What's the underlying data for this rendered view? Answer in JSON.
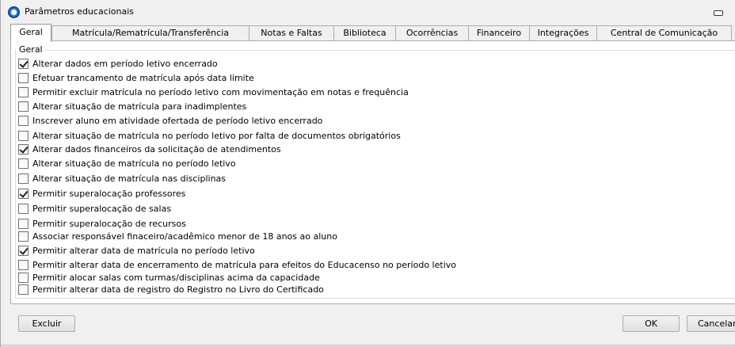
{
  "window": {
    "title": "Parâmetros educacionais"
  },
  "icons": {
    "app": "app-globe-icon",
    "minimize": "minimize-icon"
  },
  "tabs": [
    {
      "label": "Geral",
      "active": true
    },
    {
      "label": "Matrícula/Rematrícula/Transferência",
      "active": false
    },
    {
      "label": "Notas e Faltas",
      "active": false
    },
    {
      "label": "Biblioteca",
      "active": false
    },
    {
      "label": "Ocorrências",
      "active": false
    },
    {
      "label": "Financeiro",
      "active": false
    },
    {
      "label": "Integrações",
      "active": false
    },
    {
      "label": "Central de Comunicação",
      "active": false
    }
  ],
  "group": {
    "label": "Geral"
  },
  "options": [
    {
      "label": "Alterar dados em período letivo encerrado",
      "checked": true
    },
    {
      "label": "Efetuar trancamento de matrícula após data limite",
      "checked": false
    },
    {
      "label": "Permitir excluir matrícula no período letivo com movimentação em notas e frequência",
      "checked": false
    },
    {
      "label": "Alterar situação de matrícula para inadimplentes",
      "checked": false
    },
    {
      "label": "Inscrever aluno em atividade ofertada de período letivo encerrado",
      "checked": false
    },
    {
      "label": "Alterar situação de matrícula no período letivo por falta de documentos obrigatórios",
      "checked": false
    },
    {
      "label": "Alterar dados financeiros da solicitação de atendimentos",
      "checked": true
    },
    {
      "label": "Alterar situação de matrícula no período letivo",
      "checked": false
    },
    {
      "label": "Alterar situação de matrícula nas disciplinas",
      "checked": false
    },
    {
      "label": "Permitir superalocação professores",
      "checked": true
    },
    {
      "label": "Permitir superalocação de salas",
      "checked": false
    },
    {
      "label": "Permitir superalocação de recursos",
      "checked": false
    },
    {
      "label": "Associar responsável finaceiro/acadêmico menor de 18 anos ao aluno",
      "checked": false
    },
    {
      "label": "Permitir alterar data de matrícula no período letivo",
      "checked": true
    },
    {
      "label": "Permitir alterar data de encerramento de matrícula para efeitos do Educacenso no período letivo",
      "checked": false
    },
    {
      "label": "Permitir alocar salas com turmas/disciplinas acima da capacidade",
      "checked": false
    },
    {
      "label": "Permitir alterar data de registro do Registro no Livro do Certificado",
      "checked": false
    }
  ],
  "buttons": {
    "excluir": "Excluir",
    "ok": "OK",
    "cancelar": "Cancelar"
  }
}
